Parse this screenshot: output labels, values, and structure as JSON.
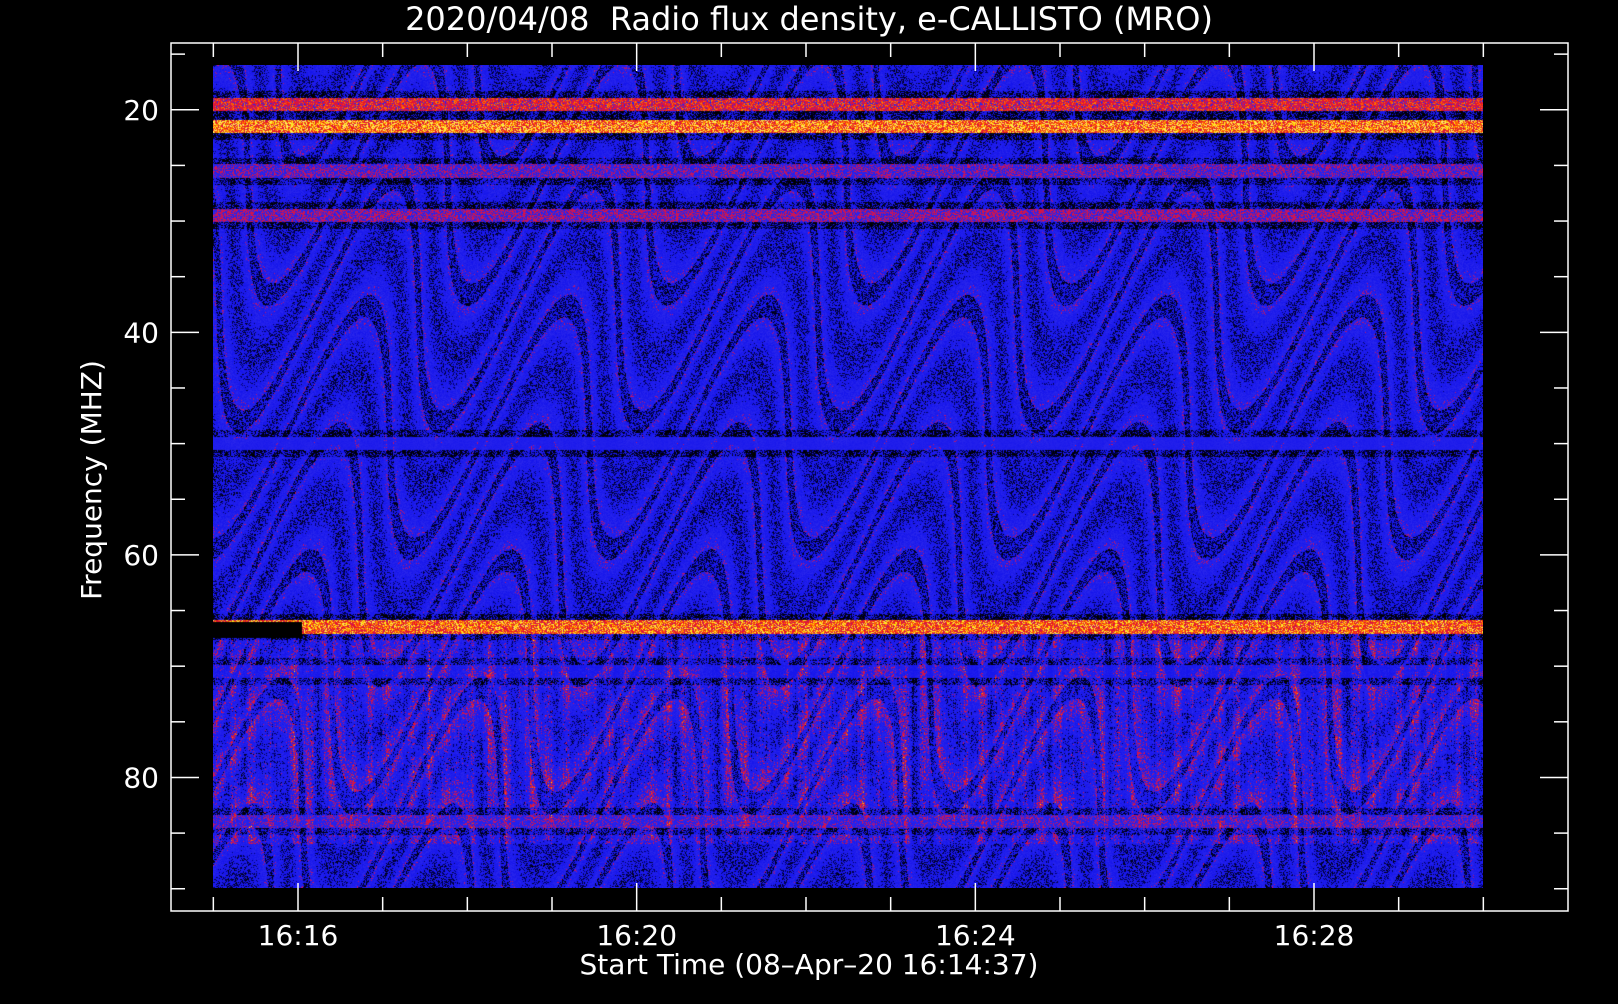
{
  "chart_data": {
    "type": "heatmap",
    "title": "2020/04/08  Radio flux density, e-CALLISTO (MRO)",
    "xlabel": "Start Time (08–Apr–20 16:14:37)",
    "ylabel": "Frequency (MHZ)",
    "x_ticks": [
      "16:16",
      "16:20",
      "16:24",
      "16:28"
    ],
    "x_tick_minutes": [
      16,
      20,
      24,
      28
    ],
    "xlim_minutes": [
      14.5,
      31.0
    ],
    "data_span_minutes": [
      15.0,
      30.0
    ],
    "y_ticks": [
      20,
      40,
      60,
      80
    ],
    "ylim": [
      14,
      92
    ],
    "data_span_mhz": [
      16,
      90
    ],
    "y_minor_step": 5,
    "x_minor_step_minutes": 1,
    "colormap": [
      "#000000",
      "#1414e6",
      "#2a2aff",
      "#c81400",
      "#ff4000",
      "#ffe64b"
    ],
    "grid": false,
    "features": [
      {
        "freq_mhz": 19.5,
        "intensity": 0.75
      },
      {
        "freq_mhz": 21.5,
        "intensity": 0.95
      },
      {
        "freq_mhz": 25.5,
        "intensity": 0.55
      },
      {
        "freq_mhz": 29.5,
        "intensity": 0.6
      },
      {
        "freq_mhz": 50,
        "intensity": 0.35
      },
      {
        "freq_mhz": 66.5,
        "intensity": 0.9
      },
      {
        "freq_mhz": 70.5,
        "intensity": 0.2
      },
      {
        "freq_mhz": 84,
        "intensity": 0.5
      }
    ]
  }
}
